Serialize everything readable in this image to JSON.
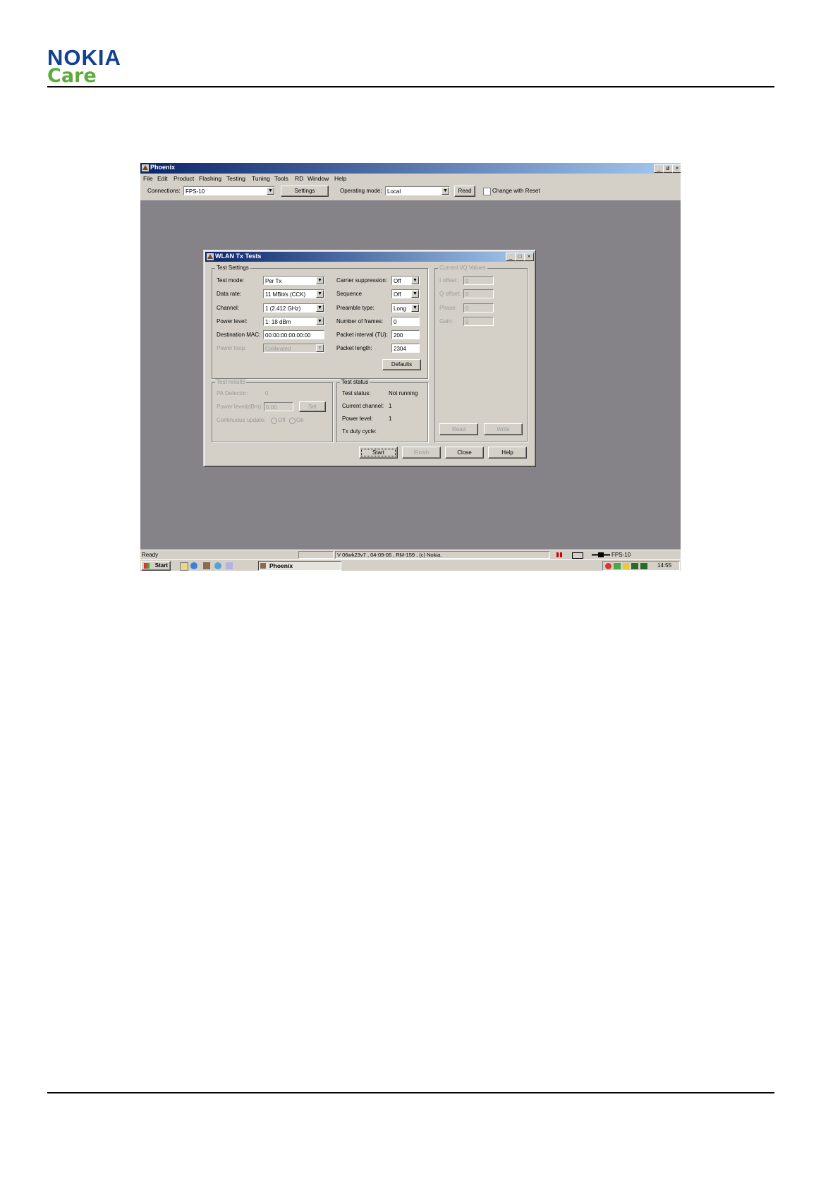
{
  "header": {
    "brand": "NOKIA",
    "sub_brand": "Care"
  },
  "app": {
    "title": "Phoenix",
    "window_buttons": [
      "_",
      "ǿ",
      "×"
    ],
    "menu": [
      "File",
      "Edit",
      "Product",
      "Flashing",
      "Testing",
      "Tuning",
      "Tools",
      "RD",
      "Window",
      "Help"
    ],
    "toolbar": {
      "connections_label": "Connections:",
      "connections_value": "FPS-10",
      "settings_button": "Settings",
      "operating_mode_label": "Operating mode:",
      "operating_mode_value": "Local",
      "read_button": "Read",
      "change_with_reset_label": "Change with Reset"
    }
  },
  "dialog": {
    "title": "WLAN Tx Tests",
    "test_settings": {
      "group_label": "Test Settings",
      "test_mode_label": "Test mode:",
      "test_mode_value": "Per Tx",
      "data_rate_label": "Data rate:",
      "data_rate_value": "11 MBit/s (CCK)",
      "channel_label": "Channel:",
      "channel_value": "1  (2.412 GHz)",
      "power_level_label": "Power level:",
      "power_level_value": "1:  18 dBm",
      "dest_mac_label": "Destination MAC:",
      "dest_mac_value": "00:00:00:00:00:00",
      "power_loop_label": "Power loop:",
      "power_loop_value": "Calibrated",
      "carrier_suppression_label": "Carrier suppression:",
      "carrier_suppression_value": "Off",
      "sequence_label": "Sequence",
      "sequence_value": "Off",
      "preamble_type_label": "Preamble type:",
      "preamble_type_value": "Long",
      "number_of_frames_label": "Number of frames:",
      "number_of_frames_value": "0",
      "packet_interval_label": "Packet interval (TU):",
      "packet_interval_value": "200",
      "packet_length_label": "Packet length:",
      "packet_length_value": "2304",
      "defaults_button": "Defaults"
    },
    "iq_values": {
      "group_label": "Current I/Q Values",
      "i_offset_label": "I offset:",
      "i_offset_value": "0",
      "q_offset_label": "Q offset:",
      "q_offset_value": "0",
      "phase_label": "Phase:",
      "phase_value": "0",
      "gain_label": "Gain:",
      "gain_value": "0",
      "read_button": "Read",
      "write_button": "Write"
    },
    "test_results": {
      "group_label": "Test results",
      "pa_detector_label": "PA Detector:",
      "pa_detector_value": "0",
      "power_level_label": "Power level(dBm):",
      "power_level_value": "0.00",
      "set_button": "Set",
      "continuous_update_label": "Continuous update:",
      "off_label": "Off",
      "on_label": "On"
    },
    "test_status": {
      "group_label": "Test status",
      "status_label": "Test status:",
      "status_value": "Not running",
      "current_channel_label": "Current channel:",
      "current_channel_value": "1",
      "power_level_label": "Power level:",
      "power_level_value": "1",
      "tx_duty_cycle_label": "Tx duty cycle:"
    },
    "buttons": {
      "start": "Start",
      "finish": "Finish",
      "close": "Close",
      "help": "Help"
    }
  },
  "statusbar": {
    "ready": "Ready",
    "version": "V 06wk23v7 , 04-09-06 , RM-159 , (c) Nokia.",
    "connection": "FPS-10"
  },
  "taskbar": {
    "start": "Start",
    "task": "Phoenix",
    "clock": "14:55"
  }
}
